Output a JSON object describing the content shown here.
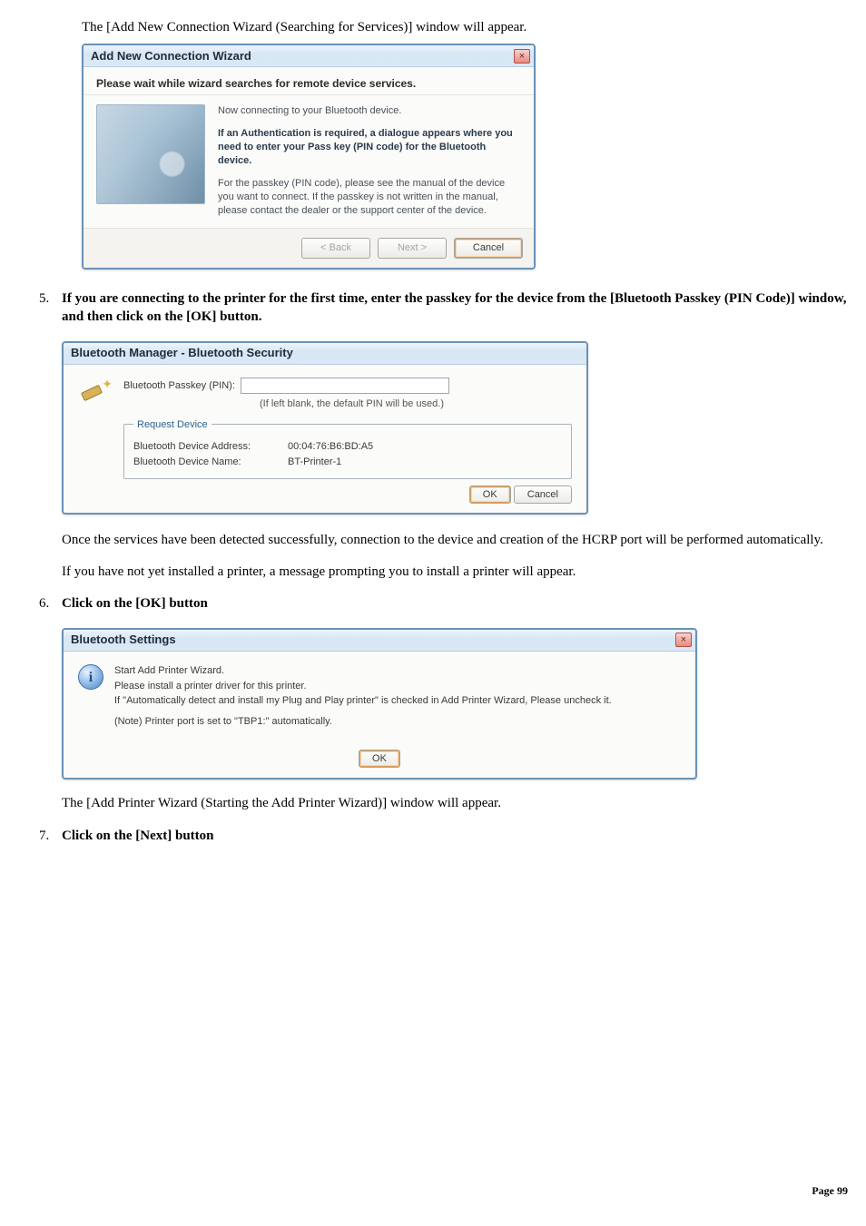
{
  "intro_text": "The [Add New Connection Wizard (Searching for Services)] window will appear.",
  "wizard": {
    "title": "Add New Connection Wizard",
    "subheader": "Please wait while wizard searches for remote device services.",
    "line1": "Now connecting to your Bluetooth device.",
    "line2": "If an Authentication is required, a dialogue appears where you need to enter your Pass key (PIN code) for the Bluetooth device.",
    "line3": "For the passkey (PIN code), please see the manual of the device you want to connect. If the passkey is not written in the manual, please contact the dealer or the support center of the device.",
    "buttons": {
      "back": "< Back",
      "next": "Next >",
      "cancel": "Cancel"
    }
  },
  "step5": {
    "text": "If you are connecting to the printer for the first time, enter the passkey for the device from the [Bluetooth Passkey (PIN Code)] window, and then click on the [OK] button."
  },
  "security": {
    "title": "Bluetooth Manager - Bluetooth Security",
    "passkey_label": "Bluetooth Passkey (PIN):",
    "hint": "(If left blank, the default PIN will be used.)",
    "legend": "Request Device",
    "addr_label": "Bluetooth Device Address:",
    "addr_value": "00:04:76:B6:BD:A5",
    "name_label": "Bluetooth Device Name:",
    "name_value": "BT-Printer-1",
    "buttons": {
      "ok": "OK",
      "cancel": "Cancel"
    }
  },
  "after5_p1": "Once the services have been detected successfully, connection to the device and creation of the HCRP port will be performed automatically.",
  "after5_p2": "If you have not yet installed a printer, a message prompting you to install a printer will appear.",
  "step6": {
    "text": "Click on the [OK] button"
  },
  "settings": {
    "title": "Bluetooth Settings",
    "line1": "Start Add Printer Wizard.",
    "line2": "Please install a printer driver for this printer.",
    "line3": "If \"Automatically detect and install my Plug and Play printer\" is checked in Add Printer Wizard, Please uncheck it.",
    "note": "(Note) Printer port is set to \"TBP1:\" automatically.",
    "ok": "OK"
  },
  "after6": "The [Add Printer Wizard (Starting the Add Printer Wizard)] window will appear.",
  "step7": {
    "text": "Click on the [Next] button"
  },
  "page_label": "Page",
  "page_number": "99"
}
